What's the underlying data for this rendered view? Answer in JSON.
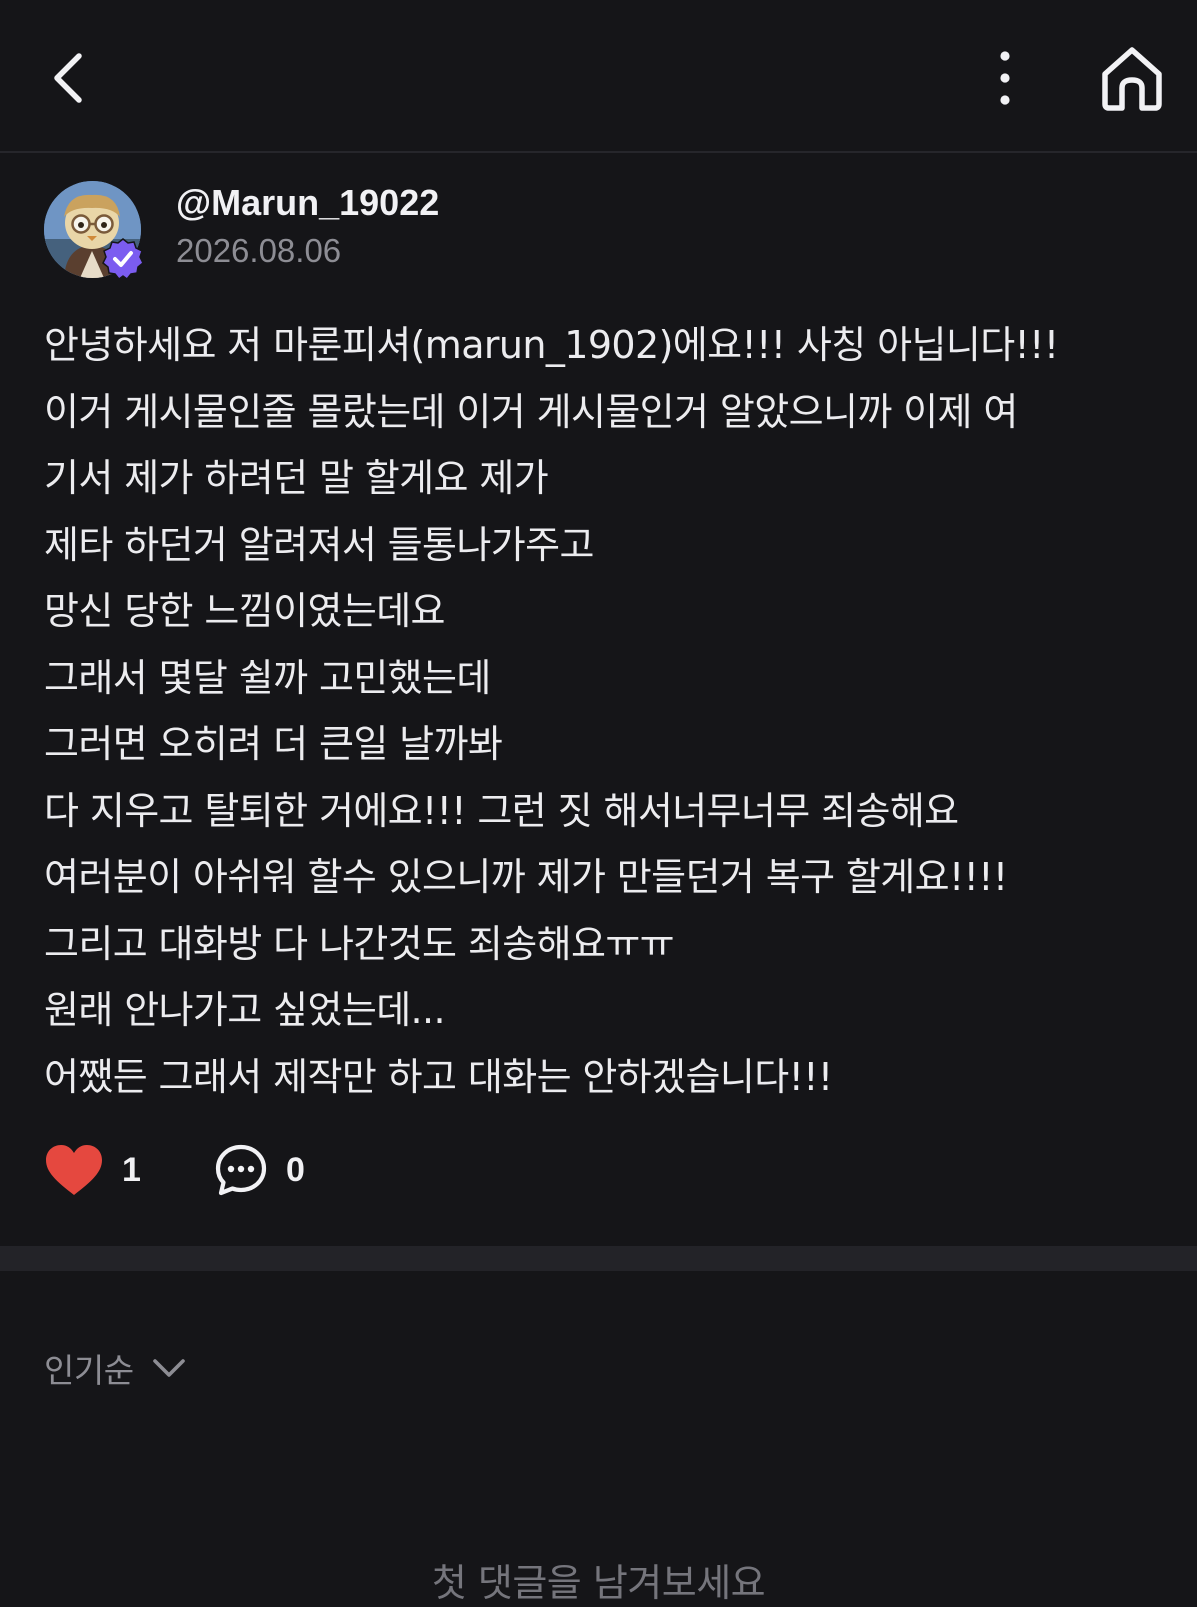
{
  "header": {
    "back_icon": "chevron-left-icon",
    "more_icon": "vertical-dots-icon",
    "home_icon": "home-icon"
  },
  "post": {
    "author": {
      "username": "@Marun_19022",
      "verified": true
    },
    "date": "2026.08.06",
    "lines": [
      "안녕하세요 저 마룬피셔(marun_1902)에요!!! 사칭 아닙니다!!!",
      "이거 게시물인줄 몰랐는데 이거 게시물인거 알았으니까 이제 여",
      "기서 제가 하려던 말 할게요 제가",
      "제타 하던거 알려져서 들통나가주고",
      "망신 당한 느낌이였는데요",
      "그래서 몇달 쉴까 고민했는데",
      "그러면 오히려 더 큰일 날까봐",
      "다 지우고 탈퇴한 거에요!!! 그런 짓 해서너무너무 죄송해요",
      "여러분이 아쉬워 할수 있으니까 제가 만들던거 복구 할게요!!!!",
      "그리고 대화방 다 나간것도 죄송해요ㅠㅠ",
      "원래 안나가고 싶었는데...",
      "어쨌든 그래서 제작만 하고 대화는 안하겠습니다!!!"
    ],
    "like_count": "1",
    "comment_count": "0"
  },
  "comments": {
    "sort_label": "인기순",
    "empty_text": "첫 댓글을 남겨보세요"
  },
  "colors": {
    "background": "#151518",
    "heart": "#e5483f",
    "verified": "#7b5cf0",
    "muted_text": "#8d8d94"
  }
}
